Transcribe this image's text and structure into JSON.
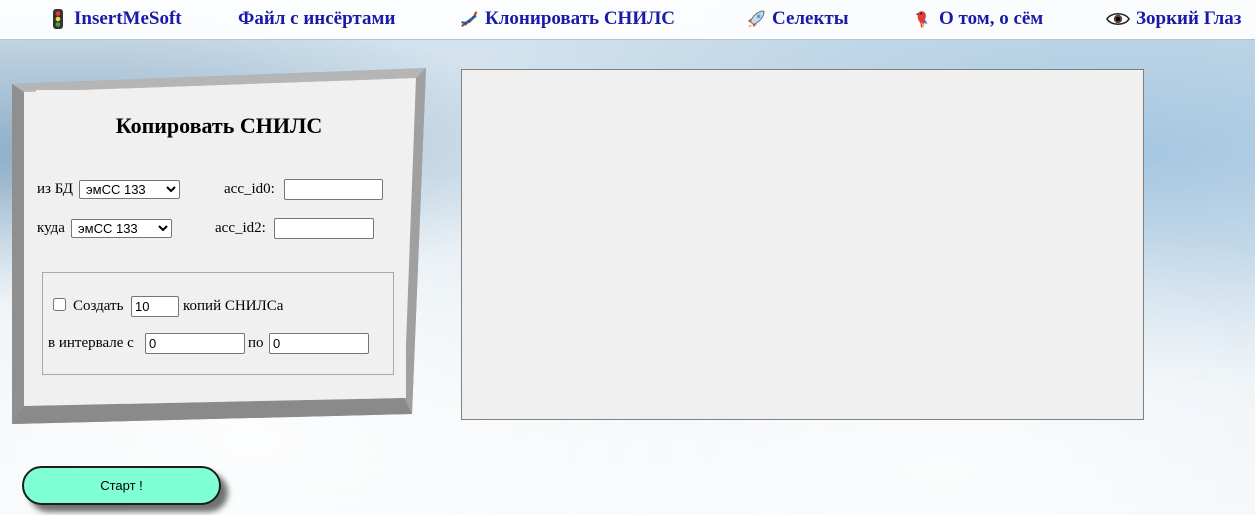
{
  "nav": {
    "items": [
      {
        "label": "InsertMeSoft",
        "icon": "traffic-light-icon"
      },
      {
        "label": "Файл с инсёртами",
        "icon": ""
      },
      {
        "label": "Клонировать СНИЛС",
        "icon": "dna-icon"
      },
      {
        "label": "Селекты",
        "icon": "rocket-icon"
      },
      {
        "label": "О том, о сём",
        "icon": "parrot-icon"
      },
      {
        "label": "Зоркий Глаз",
        "icon": "eye-icon"
      }
    ],
    "link_color": "#1a1aa8"
  },
  "panel": {
    "title": "Копировать СНИЛС",
    "from_db": {
      "label": "из БД",
      "selected": "эмСС 133"
    },
    "to_db": {
      "label": "куда",
      "selected": "эмСС 133"
    },
    "acc_id0": {
      "label": "acc_id0:",
      "value": ""
    },
    "acc_id2": {
      "label": "acc_id2:",
      "value": ""
    },
    "copies": {
      "checkbox_label": "Создать",
      "count": "10",
      "suffix": "копий СНИЛСа",
      "checked": false
    },
    "interval": {
      "from_label": "в интервале с",
      "from_value": "0",
      "to_label": "по",
      "to_value": "0"
    }
  },
  "output": {
    "text": ""
  },
  "start_button": {
    "label": "Старт !",
    "color": "#7fffd4"
  }
}
